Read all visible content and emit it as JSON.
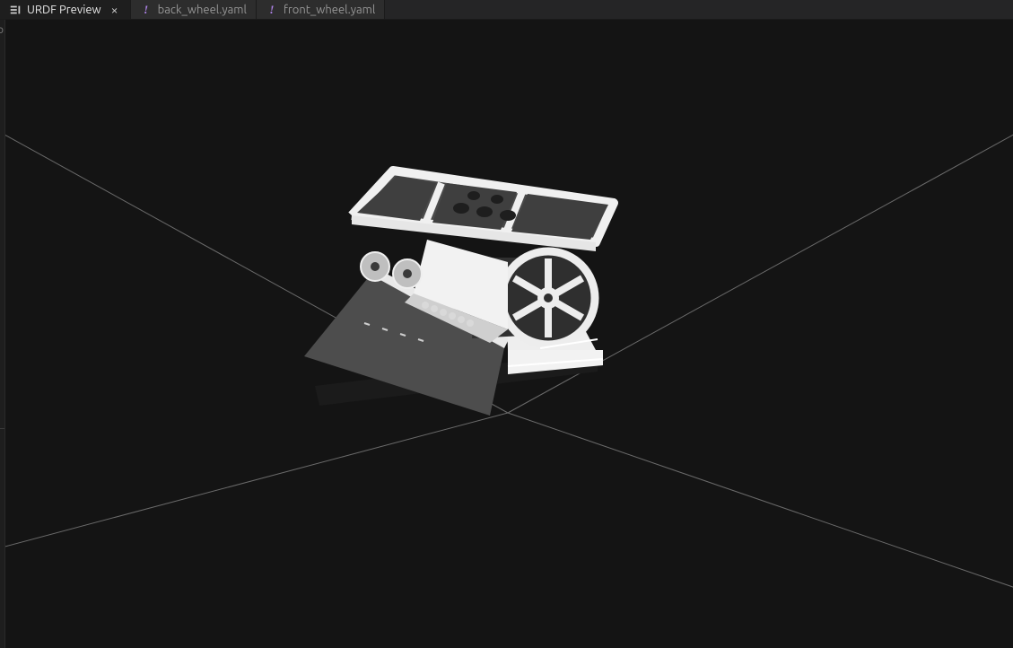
{
  "tabs": [
    {
      "label": "URDF Preview",
      "icon": "preview-icon",
      "active": true,
      "closeable": true
    },
    {
      "label": "back_wheel.yaml",
      "icon": "yaml-icon",
      "active": false,
      "closeable": false
    },
    {
      "label": "front_wheel.yaml",
      "icon": "yaml-icon",
      "active": false,
      "closeable": false
    }
  ],
  "colors": {
    "viewportBg": "#141414",
    "gridLine": "#666666",
    "modelLight": "#f5f5f5",
    "modelMedium": "#bdbdbd",
    "modelDark": "#5a5a5a",
    "modelShadow": "#3a3a3a"
  }
}
